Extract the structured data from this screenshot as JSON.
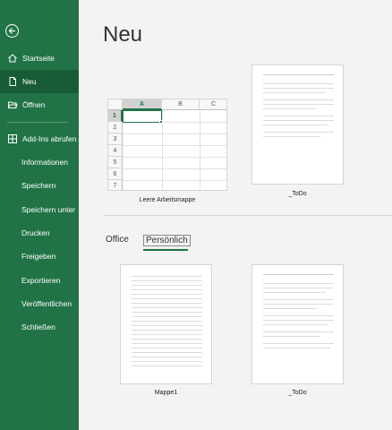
{
  "sidebar": {
    "back_icon": "back-arrow-icon",
    "items": [
      {
        "label": "Startseite",
        "icon": "home-icon"
      },
      {
        "label": "Neu",
        "icon": "new-document-icon",
        "active": true
      },
      {
        "label": "Öffnen",
        "icon": "folder-open-icon"
      },
      {
        "label": "Add-Ins abrufen",
        "icon": "grid-icon"
      },
      {
        "label": "Informationen"
      },
      {
        "label": "Speichern"
      },
      {
        "label": "Speichern unter"
      },
      {
        "label": "Drucken"
      },
      {
        "label": "Freigeben"
      },
      {
        "label": "Exportieren"
      },
      {
        "label": "Veröffentlichen"
      },
      {
        "label": "Schließen"
      }
    ]
  },
  "main": {
    "title": "Neu",
    "featured": [
      {
        "caption": "Leere Arbeitsmappe"
      },
      {
        "caption": "_ToDo"
      }
    ],
    "grid": {
      "columns": [
        "A",
        "B",
        "C"
      ],
      "rows": [
        "1",
        "2",
        "3",
        "4",
        "5",
        "6",
        "7"
      ]
    },
    "tabs": [
      {
        "label": "Office"
      },
      {
        "label": "Persönlich",
        "active": true
      }
    ],
    "templates": [
      {
        "caption": "Mappe1"
      },
      {
        "caption": "_ToDo"
      }
    ]
  },
  "colors": {
    "brand_green": "#217346",
    "active_green": "#185c37"
  }
}
